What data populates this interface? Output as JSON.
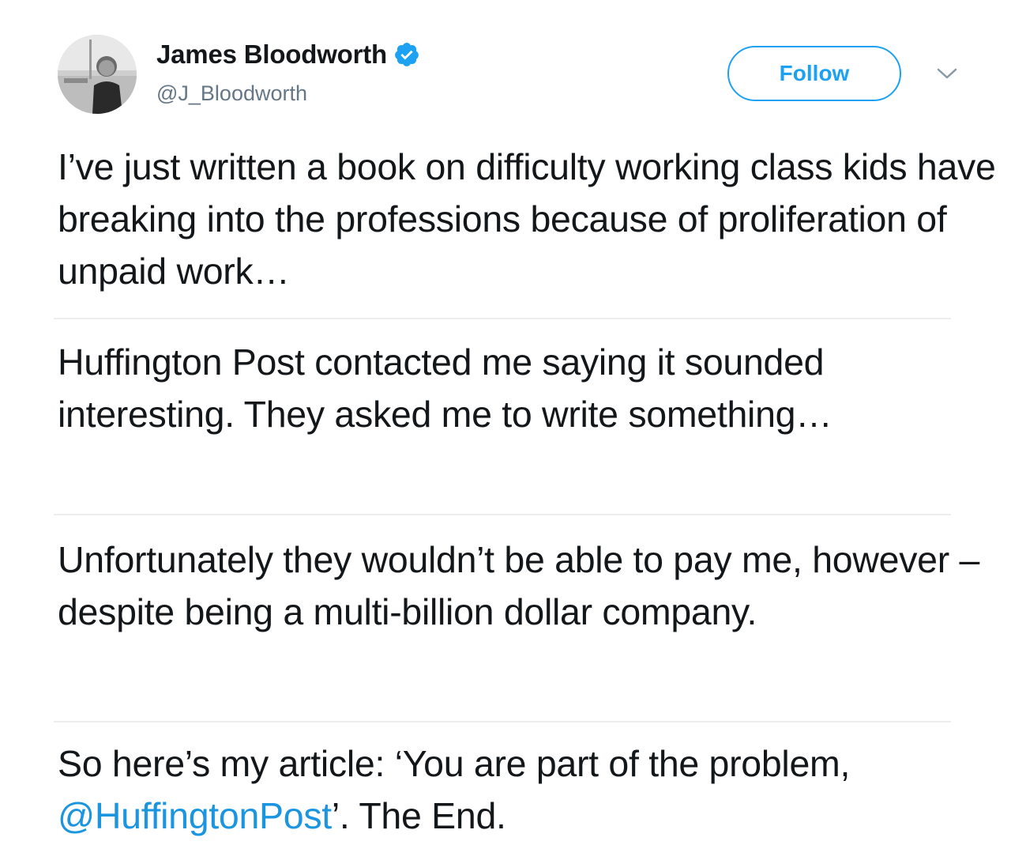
{
  "author": {
    "display_name": "James Bloodworth",
    "handle": "@J_Bloodworth",
    "verified": true,
    "avatar_icon": "profile-photo"
  },
  "actions": {
    "follow_label": "Follow",
    "more_icon": "chevron-down-icon"
  },
  "tweet": {
    "paragraphs": [
      "I’ve just written a book on difficulty working class kids have breaking into the professions because of proliferation of unpaid work…",
      "Huffington Post contacted me saying it sounded interesting. They asked me to write something…",
      "Unfortunately they wouldn’t be able to pay me, however – despite being a multi-billion dollar company."
    ],
    "last_paragraph": {
      "before": "So here’s my article: ‘You are part of the problem, ",
      "mention": "@HuffingtonPost",
      "after": "’. The End."
    }
  },
  "colors": {
    "link_blue": "#1b95e0",
    "follow_blue": "#1da1f2",
    "verified_blue": "#1da1f2",
    "text": "#14171a",
    "secondary_text": "#657786",
    "divider": "#ededed"
  }
}
